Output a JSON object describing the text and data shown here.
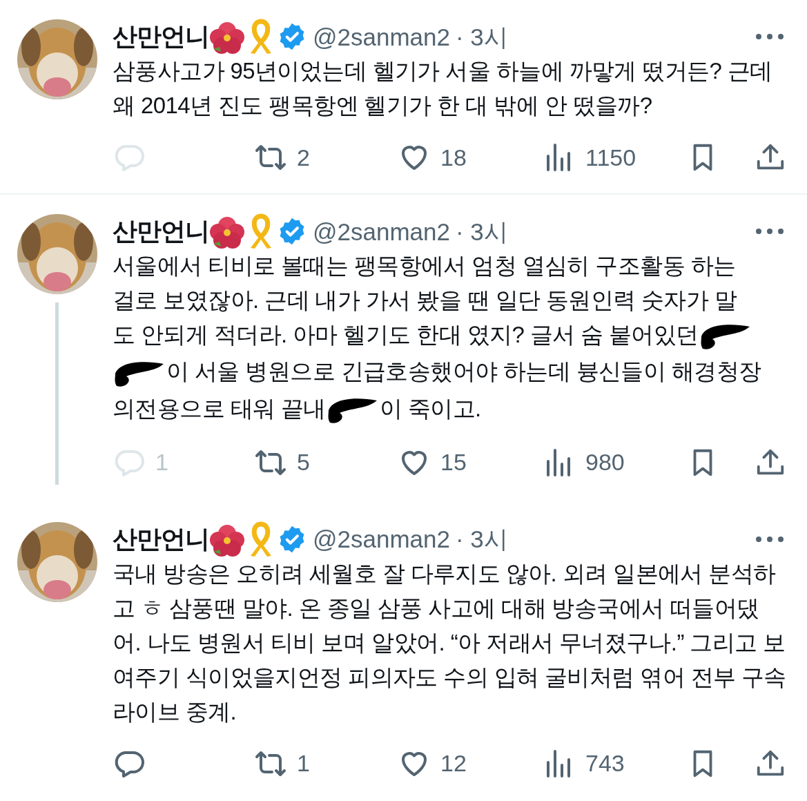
{
  "tweets": [
    {
      "name": "산만언니",
      "handle": "@2sanman2",
      "time": "· 3시",
      "thread_line": false,
      "divider": true,
      "body": [
        {
          "kind": "text",
          "text": "삼풍사고가 95년이었는데 헬기가 서울 하늘에 까맣게 떴거든? 근데 왜 2014년 진도 팽목항엔 헬기가 한 대 밖에 안 떴을까?"
        }
      ],
      "actions": {
        "reply": {
          "disabled": true
        },
        "retweets": "2",
        "likes": "18",
        "views": "1150"
      }
    },
    {
      "name": "산만언니",
      "handle": "@2sanman2",
      "time": "· 3시",
      "thread_line": true,
      "divider": false,
      "body": [
        {
          "kind": "text",
          "text": "서울에서 티비로 볼때는 팽목항에서 엄청 열심히 구조활동 하는"
        },
        {
          "kind": "newline"
        },
        {
          "kind": "text",
          "text": "걸로 보였잖아. 근데 내가 가서 봤을 땐 일단 동원인력 숫자가 말"
        },
        {
          "kind": "newline"
        },
        {
          "kind": "text",
          "text": "도 안되게 적더라. 아마 헬기도 한대 였지? 글서 숨 붙어있던"
        },
        {
          "kind": "redaction"
        },
        {
          "kind": "newline"
        },
        {
          "kind": "redaction"
        },
        {
          "kind": "text",
          "text": "이 서울 병원으로 긴급호송했어야 하는데 븅신들이 해경청장"
        },
        {
          "kind": "newline"
        },
        {
          "kind": "text",
          "text": "의전용으로 태워 끝내"
        },
        {
          "kind": "redaction"
        },
        {
          "kind": "text",
          "text": "이 죽이고."
        }
      ],
      "actions": {
        "reply": {
          "count": "1",
          "disabled": true
        },
        "retweets": "5",
        "likes": "15",
        "views": "980"
      }
    },
    {
      "name": "산만언니",
      "handle": "@2sanman2",
      "time": "· 3시",
      "thread_line": false,
      "divider": false,
      "body": [
        {
          "kind": "text",
          "text": "국내 방송은 오히려 세월호 잘 다루지도 않아. 외려 일본에서 분석하고 ㅎ 삼풍땐 말야. 온 종일 삼풍 사고에 대해 방송국에서 떠들어댔어. 나도 병원서 티비 보며 알았어. “아 저래서 무너졌구나.” 그리고 보여주기 식이었을지언정 피의자도 수의 입혀 굴비처럼 엮어 전부 구속 라이브 중계."
        }
      ],
      "actions": {
        "reply": {
          "disabled": false
        },
        "retweets": "1",
        "likes": "12",
        "views": "743"
      }
    }
  ]
}
